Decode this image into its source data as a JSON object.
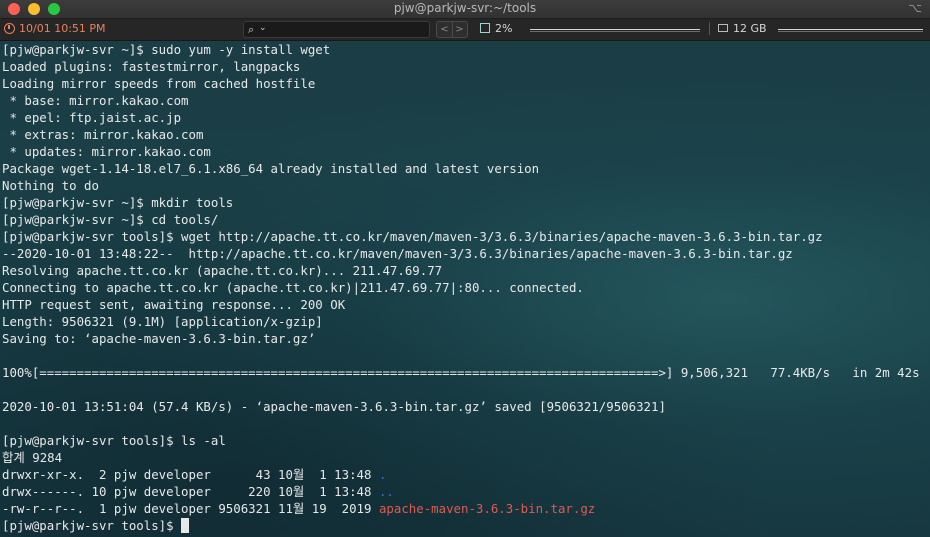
{
  "window": {
    "title": "pjw@parkjw-svr:~/tools",
    "right_icon": "⌥"
  },
  "statusbar": {
    "datetime": "10/01 10:51 PM",
    "search_icon_glyph": "⌕",
    "search_chevron": "⌄",
    "nav_prev": "<",
    "nav_next": ">",
    "cpu": "2%",
    "memory": "12 GB"
  },
  "colors": {
    "directory": "#2f6fd6",
    "archive": "#e0594f",
    "clock": "#e8825b"
  },
  "terminal": {
    "lines": [
      "[pjw@parkjw-svr ~]$ sudo yum -y install wget",
      "Loaded plugins: fastestmirror, langpacks",
      "Loading mirror speeds from cached hostfile",
      " * base: mirror.kakao.com",
      " * epel: ftp.jaist.ac.jp",
      " * extras: mirror.kakao.com",
      " * updates: mirror.kakao.com",
      "Package wget-1.14-18.el7_6.1.x86_64 already installed and latest version",
      "Nothing to do",
      "[pjw@parkjw-svr ~]$ mkdir tools",
      "[pjw@parkjw-svr ~]$ cd tools/",
      "[pjw@parkjw-svr tools]$ wget http://apache.tt.co.kr/maven/maven-3/3.6.3/binaries/apache-maven-3.6.3-bin.tar.gz",
      "--2020-10-01 13:48:22--  http://apache.tt.co.kr/maven/maven-3/3.6.3/binaries/apache-maven-3.6.3-bin.tar.gz",
      "Resolving apache.tt.co.kr (apache.tt.co.kr)... 211.47.69.77",
      "Connecting to apache.tt.co.kr (apache.tt.co.kr)|211.47.69.77|:80... connected.",
      "HTTP request sent, awaiting response... 200 OK",
      "Length: 9506321 (9.1M) [application/x-gzip]",
      "Saving to: ‘apache-maven-3.6.3-bin.tar.gz’",
      "",
      "100%[===================================================================================>] 9,506,321   77.4KB/s   in 2m 42s",
      "",
      "2020-10-01 13:51:04 (57.4 KB/s) - ‘apache-maven-3.6.3-bin.tar.gz’ saved [9506321/9506321]",
      "",
      "[pjw@parkjw-svr tools]$ ls -al",
      "합계 9284"
    ],
    "listing": [
      {
        "meta": "drwxr-xr-x.  2 pjw developer      43 10월  1 13:48 ",
        "name": "."
      },
      {
        "meta": "drwx------. 10 pjw developer     220 10월  1 13:48 ",
        "name": ".."
      },
      {
        "meta": "-rw-r--r--.  1 pjw developer 9506321 11월 19  2019 ",
        "name": "apache-maven-3.6.3-bin.tar.gz"
      }
    ],
    "prompt": "[pjw@parkjw-svr tools]$ "
  }
}
